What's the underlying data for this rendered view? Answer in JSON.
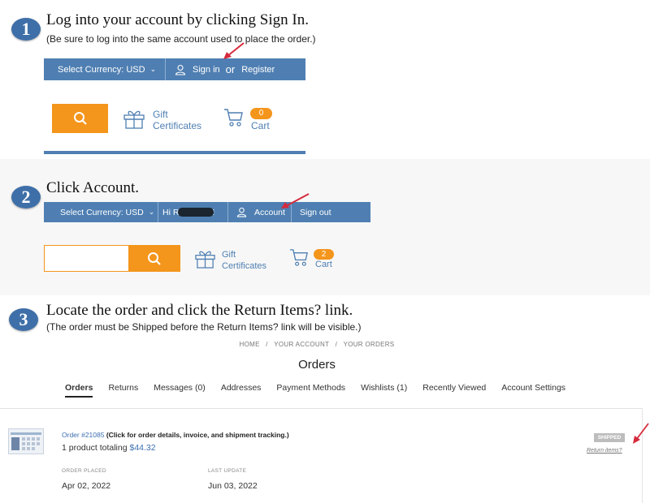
{
  "colors": {
    "nav_blue": "#4f7fb2",
    "accent_orange": "#f4951c",
    "arrow_red": "#d62a3c"
  },
  "step1": {
    "number": "1",
    "title": "Log into your account by clicking Sign In.",
    "note": "(Be sure to log into the same account used to place the order.)",
    "currency_label": "Select Currency: USD",
    "signin_label": "Sign in",
    "or_label": "or",
    "register_label": "Register",
    "gift_line1": "Gift",
    "gift_line2": "Certificates",
    "cart_count": "0",
    "cart_label": "Cart"
  },
  "step2": {
    "number": "2",
    "title": "Click Account.",
    "currency_label": "Select Currency: USD",
    "greeting": "Hi Rich Band!",
    "account_label": "Account",
    "signout_label": "Sign out",
    "gift_line1": "Gift",
    "gift_line2": "Certificates",
    "cart_count": "2",
    "cart_label": "Cart"
  },
  "step3": {
    "number": "3",
    "title": "Locate the order and click the Return Items? link.",
    "note": "(The order must be Shipped before the Return Items? link will be visible.)"
  },
  "account_page": {
    "breadcrumb": [
      "HOME",
      "/",
      "YOUR ACCOUNT",
      "/",
      "YOUR ORDERS"
    ],
    "title": "Orders",
    "tabs": [
      "Orders",
      "Returns",
      "Messages (0)",
      "Addresses",
      "Payment Methods",
      "Wishlists (1)",
      "Recently Viewed",
      "Account Settings"
    ],
    "order": {
      "link": "Order #21085",
      "note": "(Click for order details, invoice, and shipment tracking.)",
      "summary_prefix": "1 product totaling ",
      "total": "$44.32",
      "status": "SHIPPED",
      "return_link": "Return items?",
      "placed_label": "ORDER PLACED",
      "placed_value": "Apr 02, 2022",
      "update_label": "LAST UPDATE",
      "update_value": "Jun 03, 2022"
    }
  }
}
